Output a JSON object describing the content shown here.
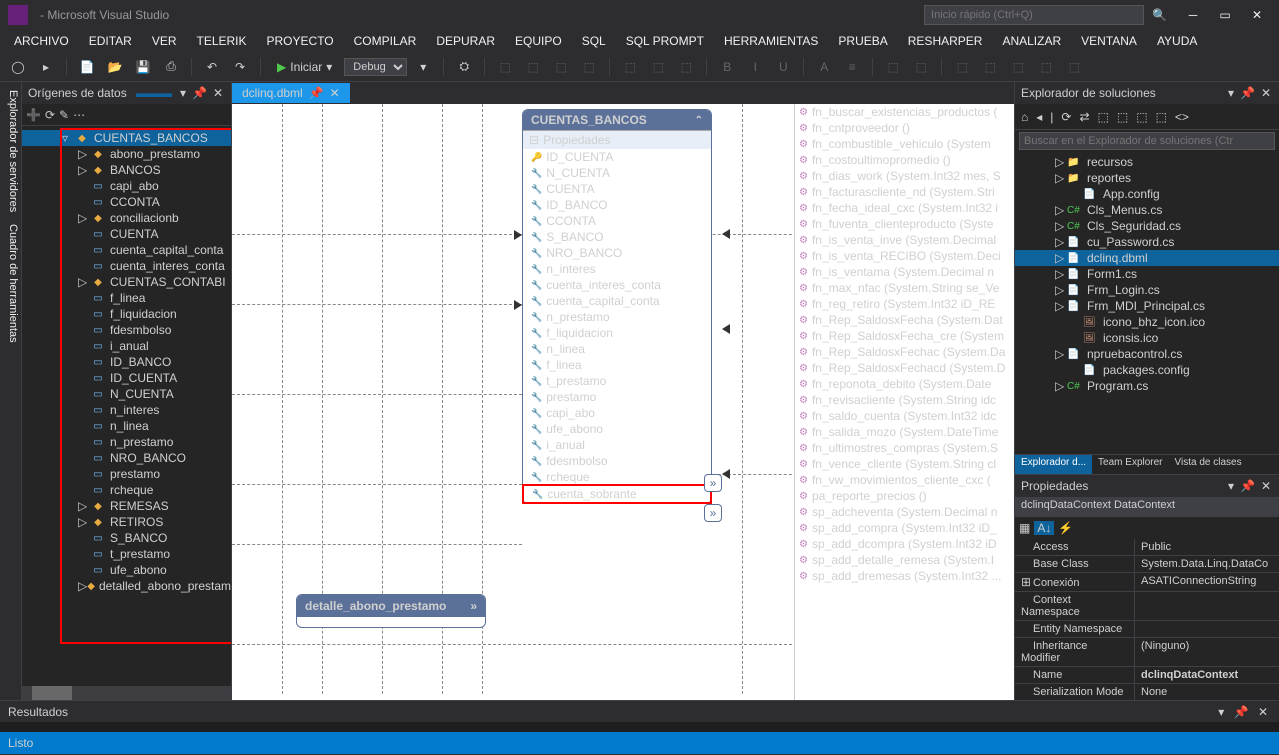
{
  "window": {
    "title": "- Microsoft Visual Studio",
    "quick_launch": "Inicio rápido (Ctrl+Q)"
  },
  "menu": [
    "ARCHIVO",
    "EDITAR",
    "VER",
    "TELERIK",
    "PROYECTO",
    "COMPILAR",
    "DEPURAR",
    "EQUIPO",
    "SQL",
    "SQL PROMPT",
    "HERRAMIENTAS",
    "PRUEBA",
    "RESHARPER",
    "ANALIZAR",
    "VENTANA",
    "AYUDA"
  ],
  "toolbar": {
    "start_label": "Iniciar",
    "config": "Debug"
  },
  "leftrail": [
    "Explorador de servidores",
    "Cuadro de herramientas"
  ],
  "datasources": {
    "title": "Orígenes de datos",
    "root": "CUENTAS_BANCOS",
    "items": [
      {
        "label": "abono_prestamo",
        "icon": "tbl",
        "exp": "▷"
      },
      {
        "label": "BANCOS",
        "icon": "tbl",
        "exp": "▷"
      },
      {
        "label": "capi_abo",
        "icon": "col"
      },
      {
        "label": "CCONTA",
        "icon": "col"
      },
      {
        "label": "conciliacionb",
        "icon": "tbl",
        "exp": "▷"
      },
      {
        "label": "CUENTA",
        "icon": "col"
      },
      {
        "label": "cuenta_capital_conta",
        "icon": "col"
      },
      {
        "label": "cuenta_interes_conta",
        "icon": "col"
      },
      {
        "label": "CUENTAS_CONTABI",
        "icon": "tbl",
        "exp": "▷"
      },
      {
        "label": "f_linea",
        "icon": "col"
      },
      {
        "label": "f_liquidacion",
        "icon": "col"
      },
      {
        "label": "fdesmbolso",
        "icon": "col"
      },
      {
        "label": "i_anual",
        "icon": "col"
      },
      {
        "label": "ID_BANCO",
        "icon": "col"
      },
      {
        "label": "ID_CUENTA",
        "icon": "col"
      },
      {
        "label": "N_CUENTA",
        "icon": "col"
      },
      {
        "label": "n_interes",
        "icon": "col"
      },
      {
        "label": "n_linea",
        "icon": "col"
      },
      {
        "label": "n_prestamo",
        "icon": "col"
      },
      {
        "label": "NRO_BANCO",
        "icon": "col"
      },
      {
        "label": "prestamo",
        "icon": "col"
      },
      {
        "label": "rcheque",
        "icon": "col"
      },
      {
        "label": "REMESAS",
        "icon": "tbl",
        "exp": "▷"
      },
      {
        "label": "RETIROS",
        "icon": "tbl",
        "exp": "▷"
      },
      {
        "label": "S_BANCO",
        "icon": "col"
      },
      {
        "label": "t_prestamo",
        "icon": "col"
      },
      {
        "label": "ufe_abono",
        "icon": "col"
      },
      {
        "label": "detalled_abono_prestam",
        "icon": "tbl",
        "exp": "▷"
      }
    ]
  },
  "tabs": [
    {
      "label": "dclinq.dbml",
      "active": true
    }
  ],
  "entity": {
    "title": "CUENTAS_BANCOS",
    "section": "Propiedades",
    "rows": [
      {
        "label": "ID_CUENTA",
        "key": true
      },
      {
        "label": "N_CUENTA"
      },
      {
        "label": "CUENTA"
      },
      {
        "label": "ID_BANCO"
      },
      {
        "label": "CCONTA"
      },
      {
        "label": "S_BANCO"
      },
      {
        "label": "NRO_BANCO"
      },
      {
        "label": "n_interes"
      },
      {
        "label": "cuenta_interes_conta"
      },
      {
        "label": "cuenta_capital_conta"
      },
      {
        "label": "n_prestamo"
      },
      {
        "label": "f_liquidacion"
      },
      {
        "label": "n_linea"
      },
      {
        "label": "f_linea"
      },
      {
        "label": "t_prestamo"
      },
      {
        "label": "prestamo"
      },
      {
        "label": "capi_abo"
      },
      {
        "label": "ufe_abono"
      },
      {
        "label": "i_anual"
      },
      {
        "label": "fdesmbolso"
      },
      {
        "label": "rcheque"
      },
      {
        "label": "cuenta_sobrante",
        "highlight": true
      }
    ]
  },
  "small_entity": {
    "title": "detalle_abono_prestamo"
  },
  "methods": [
    "fn_buscar_existencias_productos (",
    "fn_cntproveedor ()",
    "fn_combustible_vehiculo (System",
    "fn_costoultimopromedio ()",
    "fn_dias_work (System.Int32 mes, S",
    "fn_facturascliente_nd (System.Stri",
    "fn_fecha_ideal_cxc (System.Int32 i",
    "fn_fuventa_clienteproducto (Syste",
    "fn_is_venta_inve (System.Decimal",
    "fn_is_venta_RECIBO (System.Deci",
    "fn_is_ventama (System.Decimal n",
    "fn_max_nfac (System.String se_Ve",
    "fn_reg_retiro (System.Int32 iD_RE",
    "fn_Rep_SaldosxFecha (System.Dat",
    "fn_Rep_SaldosxFecha_cre (System",
    "fn_Rep_SaldosxFechac (System.Da",
    "fn_Rep_SaldosxFechacd (System.D",
    "fn_reponota_debito (System.Date",
    "fn_revisacliente (System.String idc",
    "fn_saldo_cuenta (System.Int32 idc",
    "fn_salida_mozo (System.DateTime",
    "fn_ultimostres_compras (System.S",
    "fn_vence_cliente (System.String cl",
    "fn_vw_movimientos_cliente_cxc (",
    "pa_reporte_precios ()",
    "sp_adcheventa (System.Decimal n",
    "sp_add_compra (System.Int32 iD_",
    "sp_add_dcompra (System.Int32 iD",
    "sp_add_detalle_remesa (System.I",
    "sp_add_dremesas (System.Int32 ..."
  ],
  "solution": {
    "title": "Explorador de soluciones",
    "search": "Buscar en el Explorador de soluciones (Ctr",
    "items": [
      {
        "label": "recursos",
        "icon": "folder",
        "exp": "▷",
        "indent": 40
      },
      {
        "label": "reportes",
        "icon": "folder",
        "exp": "▷",
        "indent": 40
      },
      {
        "label": "App.config",
        "icon": "cfg",
        "indent": 56
      },
      {
        "label": "Cls_Menus.cs",
        "icon": "cs",
        "exp": "▷",
        "indent": 40
      },
      {
        "label": "Cls_Seguridad.cs",
        "icon": "cs",
        "exp": "▷",
        "indent": 40
      },
      {
        "label": "cu_Password.cs",
        "icon": "cfg",
        "exp": "▷",
        "indent": 40
      },
      {
        "label": "dclinq.dbml",
        "icon": "cfg",
        "exp": "▷",
        "indent": 40,
        "sel": true
      },
      {
        "label": "Form1.cs",
        "icon": "cfg",
        "exp": "▷",
        "indent": 40
      },
      {
        "label": "Frm_Login.cs",
        "icon": "cfg",
        "exp": "▷",
        "indent": 40
      },
      {
        "label": "Frm_MDI_Principal.cs",
        "icon": "cfg",
        "exp": "▷",
        "indent": 40
      },
      {
        "label": "icono_bhz_icon.ico",
        "icon": "ico",
        "indent": 56
      },
      {
        "label": "iconsis.ico",
        "icon": "ico",
        "indent": 56
      },
      {
        "label": "npruebacontrol.cs",
        "icon": "cfg",
        "exp": "▷",
        "indent": 40
      },
      {
        "label": "packages.config",
        "icon": "cfg",
        "indent": 56
      },
      {
        "label": "Program.cs",
        "icon": "cs",
        "exp": "▷",
        "indent": 40
      }
    ],
    "tabs": [
      "Explorador d...",
      "Team Explorer",
      "Vista de clases"
    ]
  },
  "properties": {
    "title": "Propiedades",
    "subtitle": "dclinqDataContext DataContext",
    "rows": [
      {
        "name": "Access",
        "val": "Public"
      },
      {
        "name": "Base Class",
        "val": "System.Data.Linq.DataCo"
      },
      {
        "name": "Conexión",
        "val": "ASATIConnectionString",
        "exp": "⊞"
      },
      {
        "name": "Context Namespace",
        "val": ""
      },
      {
        "name": "Entity Namespace",
        "val": ""
      },
      {
        "name": "Inheritance Modifier",
        "val": "(Ninguno)"
      },
      {
        "name": "Name",
        "val": "dclinqDataContext",
        "bold": true
      },
      {
        "name": "Serialization Mode",
        "val": "None"
      }
    ]
  },
  "results_title": "Resultados",
  "status": "Listo"
}
